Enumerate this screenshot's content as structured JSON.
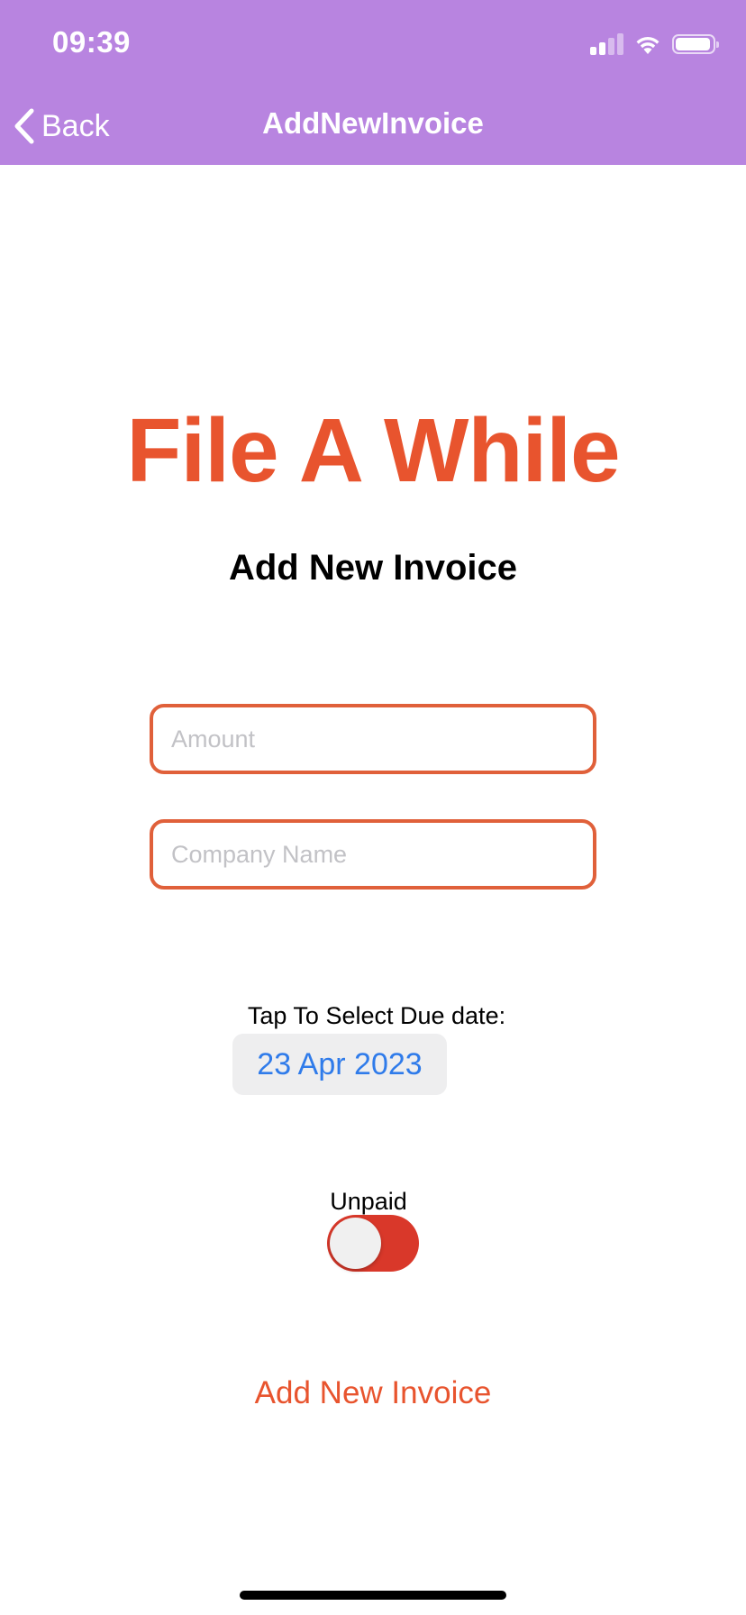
{
  "status_bar": {
    "time": "09:39",
    "battery_level": 0.95,
    "signal_bars_filled": 2,
    "signal_bars_total": 4
  },
  "nav": {
    "back_label": "Back",
    "title": "AddNewInvoice",
    "background_color": "#b884e0"
  },
  "main": {
    "app_title": "File A While",
    "heading": "Add New Invoice",
    "amount_placeholder": "Amount",
    "company_placeholder": "Company Name",
    "due_label": "Tap To Select Due date:",
    "due_date": "23 Apr 2023",
    "status_label": "Unpaid",
    "status_toggle_on": false,
    "submit_label": "Add New Invoice"
  },
  "colors": {
    "accent": "#e8542e",
    "field_border": "#e0603a",
    "date_text": "#2f7bea",
    "toggle_track": "#d9382a"
  }
}
